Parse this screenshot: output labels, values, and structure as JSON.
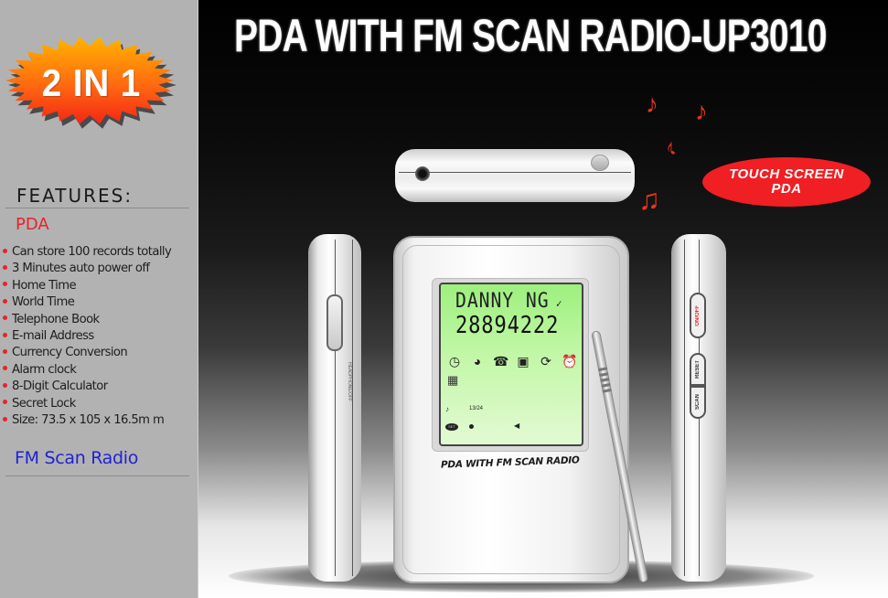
{
  "sidebar": {
    "badge": "2 IN 1",
    "features_title": "FEATURES:",
    "pda_heading": "PDA",
    "pda_features": [
      "Can store 100 records totally",
      "3 Minutes auto power off",
      "Home Time",
      "World Time",
      "Telephone Book",
      "E-mail Address",
      "Currency Conversion",
      "Alarm clock",
      "8-Digit Calculator",
      "Secret Lock",
      "Size: 73.5 x 105 x 16.5m m"
    ],
    "fm_heading": "FM Scan Radio"
  },
  "main": {
    "title": "PDA WITH FM SCAN RADIO-UP3010",
    "badge": {
      "line1": "TOUCH SCREEN",
      "line2": "PDA"
    },
    "device": {
      "brand_text": "PDA WITH FM SCAN RADIO",
      "lcd": {
        "name": "DANNY NG",
        "number": "28894222",
        "time": "13/24",
        "set_label": "SET",
        "icons": [
          "clock-icon",
          "globe-icon",
          "telephone-icon",
          "email-icon",
          "currency-exchange-icon",
          "alarm-clock-icon",
          "calculator-icon"
        ]
      },
      "side_buttons": {
        "onoff": "ON/OFF",
        "reset": "RESET",
        "scan": "SCAN"
      },
      "side_print": "HEADPHONE/OFF"
    }
  },
  "colors": {
    "sidebar_bg": "#b2b2b2",
    "accent_red": "#e8232a",
    "fm_blue": "#2121d6",
    "lcd_green": "#b6f498",
    "note_orange": "#e8341c"
  }
}
